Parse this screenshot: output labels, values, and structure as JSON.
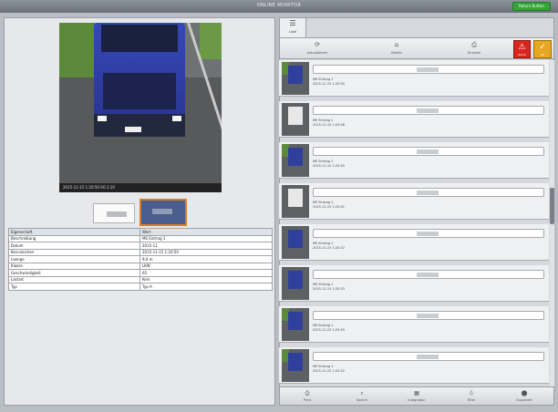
{
  "window": {
    "title": "ONLINE MONITOR",
    "top_button": "Return Button"
  },
  "photo": {
    "caption": "2015-11-15 1:20:50 IIO 2.10"
  },
  "properties": {
    "headers": [
      "Eigenschaft",
      "Wert"
    ],
    "rows": [
      [
        "Beschreibung",
        "ME Eintrag 1"
      ],
      [
        "Datum",
        "2015-11"
      ],
      [
        "Kennzeichen",
        "2015-11-15 1:20:50"
      ],
      [
        "Laenge",
        "9,0 m"
      ],
      [
        "Klasse",
        "LKW"
      ],
      [
        "Geschwindigkeit",
        "65"
      ],
      [
        "Lastart",
        "Kein"
      ],
      [
        "Typ",
        "Typ A"
      ]
    ]
  },
  "right": {
    "tab_label": "Liste",
    "toolbar": {
      "t1": "Aktualisieren",
      "t2": "Details",
      "t3": "Drucken",
      "alarm": "Alarm",
      "ok": "OK"
    },
    "items": [
      {
        "line1": "ME Eintrag 1",
        "line2": "2015-11-15 1:20:50"
      },
      {
        "line1": "ME Eintrag 1",
        "line2": "2015-11-15 1:20:48"
      },
      {
        "line1": "ME Eintrag 1",
        "line2": "2015-11-15 1:20:45"
      },
      {
        "line1": "ME Eintrag 1",
        "line2": "2015-11-15 1:20:41"
      },
      {
        "line1": "ME Eintrag 1",
        "line2": "2015-11-15 1:20:37"
      },
      {
        "line1": "ME Eintrag 1",
        "line2": "2015-11-15 1:20:33"
      },
      {
        "line1": "ME Eintrag 1",
        "line2": "2015-11-15 1:20:29"
      },
      {
        "line1": "ME Eintrag 1",
        "line2": "2015-11-15 1:20:22"
      }
    ],
    "bottombar": [
      "Print",
      "Search",
      "Integration",
      "Filter",
      "Exportiert"
    ]
  }
}
